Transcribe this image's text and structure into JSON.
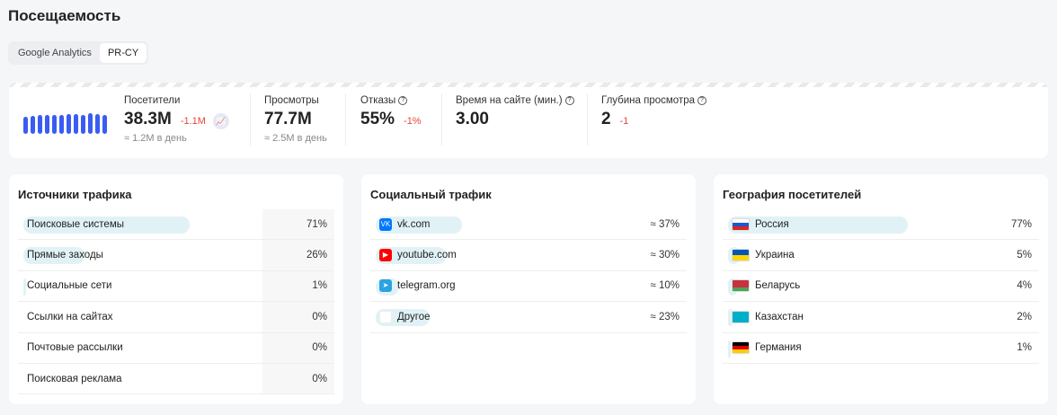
{
  "title": "Посещаемость",
  "tabs": [
    {
      "label": "Google Analytics"
    },
    {
      "label": "PR-CY"
    }
  ],
  "stats": {
    "visitors": {
      "label": "Посетители",
      "value": "38.3M",
      "delta": "-1.1M",
      "sub": "≈ 1.2M в день"
    },
    "views": {
      "label": "Просмотры",
      "value": "77.7M",
      "sub": "≈ 2.5M в день"
    },
    "bounce": {
      "label": "Отказы",
      "value": "55%",
      "delta": "-1%"
    },
    "time": {
      "label": "Время на сайте (мин.)",
      "value": "3.00"
    },
    "depth": {
      "label": "Глубина просмотра",
      "value": "2",
      "delta": "-1"
    },
    "spark": [
      0.8,
      0.82,
      0.85,
      0.85,
      0.85,
      0.85,
      0.9,
      0.92,
      0.88,
      0.95,
      0.9,
      0.85
    ]
  },
  "traffic": {
    "title": "Источники трафика",
    "rows": [
      {
        "name": "Поисковые системы",
        "pct": "71%",
        "v": 71
      },
      {
        "name": "Прямые заходы",
        "pct": "26%",
        "v": 26
      },
      {
        "name": "Социальные сети",
        "pct": "1%",
        "v": 1
      },
      {
        "name": "Ссылки на сайтах",
        "pct": "0%",
        "v": 0
      },
      {
        "name": "Почтовые рассылки",
        "pct": "0%",
        "v": 0
      },
      {
        "name": "Поисковая реклама",
        "pct": "0%",
        "v": 0
      }
    ]
  },
  "social": {
    "title": "Социальный трафик",
    "rows": [
      {
        "name": "vk.com",
        "pct": "≈ 37%",
        "v": 37,
        "icon": "vk-icon",
        "color": "#0077ff",
        "glyph": "VK"
      },
      {
        "name": "youtube.com",
        "pct": "≈ 30%",
        "v": 30,
        "icon": "youtube-icon",
        "color": "#ff0000",
        "glyph": "▶"
      },
      {
        "name": "telegram.org",
        "pct": "≈ 10%",
        "v": 10,
        "icon": "telegram-icon",
        "color": "#2aa3e0",
        "glyph": "➤"
      },
      {
        "name": "Другое",
        "pct": "≈ 23%",
        "v": 23,
        "icon": "other-icon",
        "color": "#ffffff",
        "glyph": ""
      }
    ]
  },
  "geo": {
    "title": "География посетителей",
    "rows": [
      {
        "name": "Россия",
        "pct": "77%",
        "v": 77,
        "flag": [
          "#fff",
          "#1c57d6",
          "#d52b1e"
        ]
      },
      {
        "name": "Украина",
        "pct": "5%",
        "v": 5,
        "flag": [
          "#0057b7",
          "#ffd700"
        ]
      },
      {
        "name": "Беларусь",
        "pct": "4%",
        "v": 4,
        "flag": [
          "#c8313e",
          "#c8313e",
          "#4aa657"
        ]
      },
      {
        "name": "Казахстан",
        "pct": "2%",
        "v": 2,
        "flag": [
          "#00afca"
        ]
      },
      {
        "name": "Германия",
        "pct": "1%",
        "v": 1,
        "flag": [
          "#000",
          "#dd0000",
          "#ffce00"
        ]
      }
    ]
  }
}
